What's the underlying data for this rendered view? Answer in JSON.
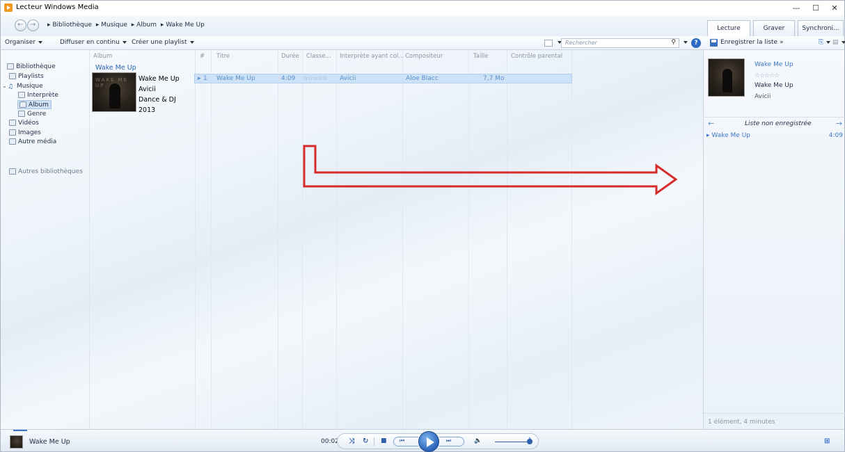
{
  "window": {
    "title": "Lecteur Windows Media",
    "minimize": "—",
    "maximize": "☐",
    "close": "✕"
  },
  "breadcrumb": [
    "▸ Bibliothèque",
    "▸ Musique",
    "▸ Album",
    "▸ Wake Me Up"
  ],
  "tabs": [
    "Lecture",
    "Graver",
    "Synchroni..."
  ],
  "toolbar": {
    "organize": "Organiser",
    "stream": "Diffuser en continu",
    "create_playlist": "Créer une playlist",
    "search_placeholder": "Rechercher"
  },
  "right_toolbar": {
    "save_list": "Enregistrer la liste",
    "more": "»"
  },
  "nav": [
    {
      "label": "Bibliothèque",
      "icon": "library-icon",
      "indent": 0
    },
    {
      "label": "Playlists",
      "icon": "playlist-icon",
      "indent": 1
    },
    {
      "label": "Musique",
      "icon": "music-note-icon",
      "indent": 0,
      "expanded": true
    },
    {
      "label": "Interprète",
      "icon": "artist-icon",
      "indent": 2
    },
    {
      "label": "Album",
      "icon": "album-icon",
      "indent": 2,
      "selected": true
    },
    {
      "label": "Genre",
      "icon": "genre-icon",
      "indent": 2
    },
    {
      "label": "Vidéos",
      "icon": "video-icon",
      "indent": 1
    },
    {
      "label": "Images",
      "icon": "image-icon",
      "indent": 1
    },
    {
      "label": "Autre média",
      "icon": "other-media-icon",
      "indent": 1
    },
    {
      "label": "Autres bibliothèques",
      "icon": "other-libraries-icon",
      "indent": 1
    }
  ],
  "columns": [
    "Album",
    "#",
    "Titre",
    "Durée",
    "Classe...",
    "Interprète ayant col...",
    "Compositeur",
    "Taille",
    "Contrôle parental"
  ],
  "album": {
    "group_label": "Wake Me Up",
    "title": "Wake Me Up",
    "artist": "Avicii",
    "genre": "Dance & DJ",
    "year": "2013"
  },
  "tracks": [
    {
      "num": "1",
      "title": "Wake Me Up",
      "duration": "4:09",
      "rating": "☆☆☆☆☆",
      "contributing_artist": "Avicii",
      "composer": "Aloe Blacc",
      "size": "7,7 Mo"
    }
  ],
  "now_playing_panel": {
    "title": "Wake Me Up",
    "rating": "☆☆☆☆☆",
    "album": "Wake Me Up",
    "artist": "Avicii",
    "list_title": "Liste non enregistrée",
    "items": [
      {
        "title": "Wake Me Up",
        "duration": "4:09"
      }
    ],
    "status": "1 élément, 4 minutes"
  },
  "player": {
    "now_playing": "Wake Me Up",
    "elapsed": "00:02"
  },
  "colors": {
    "accent": "#2e6bc5",
    "selection": "#cde2f6",
    "arrow": "#d62b2b"
  }
}
